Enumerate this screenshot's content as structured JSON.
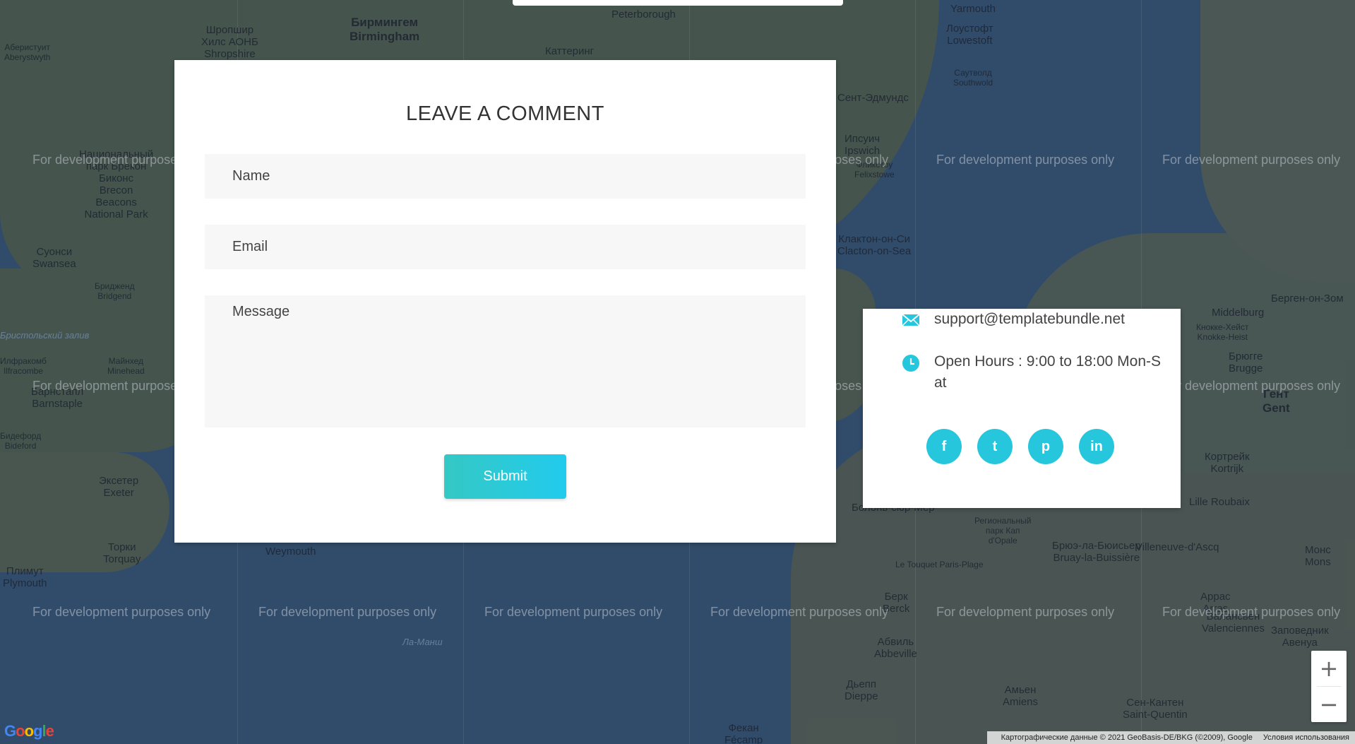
{
  "comment_form": {
    "title": "LEAVE A COMMENT",
    "name_placeholder": "Name",
    "email_placeholder": "Email",
    "message_placeholder": "Message",
    "submit_label": "Submit"
  },
  "contact": {
    "email": "support@templatebundle.net",
    "hours": "Open Hours : 9:00 to 18:00 Mon-Sat",
    "socials": [
      {
        "name": "facebook",
        "glyph": "f"
      },
      {
        "name": "twitter",
        "glyph": "t"
      },
      {
        "name": "pinterest",
        "glyph": "p"
      },
      {
        "name": "linkedin",
        "glyph": "in"
      }
    ]
  },
  "map": {
    "watermark": "For development purposes only",
    "zoom_in": "+",
    "zoom_out": "−",
    "logo": "Google",
    "attribution": "Картографические данные © 2021 GeoBasis-DE/BKG (©2009), Google",
    "terms": "Условия использования",
    "places": [
      {
        "text": "Бирмингем\nBirmingham",
        "cls": "big"
      },
      {
        "text": "Шропшир\nХилс АОНБ\nShropshire",
        "cls": ""
      },
      {
        "text": "Peterborough",
        "cls": ""
      },
      {
        "text": "Yarmouth",
        "cls": ""
      },
      {
        "text": "Лоустофт\nLowestoft",
        "cls": ""
      },
      {
        "text": "Аберистуит\nAberystwyth",
        "cls": "small"
      },
      {
        "text": "Каттеринг",
        "cls": ""
      },
      {
        "text": "Саутволд\nSouthwold",
        "cls": "small"
      },
      {
        "text": "Сент-Эдмундс",
        "cls": ""
      },
      {
        "text": "Ипсуич\nIpswich",
        "cls": ""
      },
      {
        "text": "Фликстоу\nFelixstowe",
        "cls": "small"
      },
      {
        "text": "Национальный\nпарк Брекон\nБиконс\nBrecon\nBeacons\nNational Park",
        "cls": ""
      },
      {
        "text": "Суонси\nSwansea",
        "cls": ""
      },
      {
        "text": "Бридженд\nBridgend",
        "cls": "small"
      },
      {
        "text": "Клактон-он-Си\nClacton-on-Sea",
        "cls": ""
      },
      {
        "text": "Бристольский залив",
        "cls": "sea"
      },
      {
        "text": "Майнхед\nMinehead",
        "cls": "small"
      },
      {
        "text": "Илфракомб\nIlfracombe",
        "cls": "small"
      },
      {
        "text": "Барнстапл\nBarnstaple",
        "cls": ""
      },
      {
        "text": "Бидефорд\nBideford",
        "cls": "small"
      },
      {
        "text": "Эксетер\nExeter",
        "cls": ""
      },
      {
        "text": "Торки\nTorquay",
        "cls": ""
      },
      {
        "text": "Плимут\nPlymouth",
        "cls": ""
      },
      {
        "text": "Weymouth",
        "cls": ""
      },
      {
        "text": "Ла-Манш",
        "cls": "sea"
      },
      {
        "text": "Middelburg",
        "cls": ""
      },
      {
        "text": "Кнокке-Хейст\nKnokke-Heist",
        "cls": "small"
      },
      {
        "text": "Брюгге\nBrugge",
        "cls": ""
      },
      {
        "text": "Гент\nGent",
        "cls": "big"
      },
      {
        "text": "Кортрейк\nKortrijk",
        "cls": ""
      },
      {
        "text": "Lille Roubaix",
        "cls": ""
      },
      {
        "text": "Болонь-сюр-Мер",
        "cls": ""
      },
      {
        "text": "Региональный\nпарк Кап\nd'Opale",
        "cls": "small"
      },
      {
        "text": "Брюэ-ла-Бюисьер\nBruay-la-Buissière",
        "cls": ""
      },
      {
        "text": "Le Touquet Paris-Plage",
        "cls": "small"
      },
      {
        "text": "Villeneuve-d'Ascq",
        "cls": ""
      },
      {
        "text": "Монс\nMons",
        "cls": ""
      },
      {
        "text": "Аррас\nArras",
        "cls": ""
      },
      {
        "text": "Валансьен\nValenciennes",
        "cls": ""
      },
      {
        "text": "Берк\nBerck",
        "cls": ""
      },
      {
        "text": "Абвиль\nAbbeville",
        "cls": ""
      },
      {
        "text": "Амьен\nAmiens",
        "cls": ""
      },
      {
        "text": "Сен-Кантен\nSaint-Quentin",
        "cls": ""
      },
      {
        "text": "Дьепп\nDieppe",
        "cls": ""
      },
      {
        "text": "Фекан\nFécamp",
        "cls": ""
      },
      {
        "text": "Берген-он-Зом",
        "cls": ""
      },
      {
        "text": "Заповедник\nАвенуа",
        "cls": ""
      }
    ]
  }
}
